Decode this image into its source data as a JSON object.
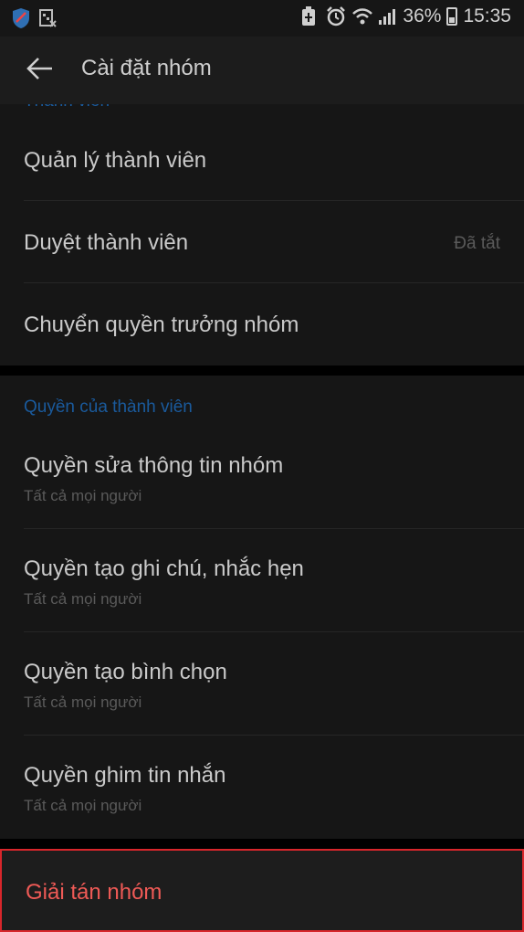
{
  "status_bar": {
    "battery_percent": "36%",
    "time": "15:35",
    "left_icons": [
      "shield-app-icon",
      "tablet-app-icon"
    ],
    "right_icons": [
      "battery-saver-icon",
      "alarm-icon",
      "wifi-icon",
      "signal-icon",
      "battery-icon"
    ]
  },
  "app_bar": {
    "title": "Cài đặt nhóm",
    "back_icon": "arrow-left-icon"
  },
  "section_members": {
    "header": "Thành viên",
    "items": [
      {
        "title": "Quản lý thành viên"
      },
      {
        "title": "Duyệt thành viên",
        "value": "Đã tắt"
      },
      {
        "title": "Chuyển quyền trưởng nhóm"
      }
    ]
  },
  "section_permissions": {
    "header": "Quyền của thành viên",
    "items": [
      {
        "title": "Quyền sửa thông tin nhóm",
        "subtitle": "Tất cả mọi người"
      },
      {
        "title": "Quyền tạo ghi chú, nhắc hẹn",
        "subtitle": "Tất cả mọi người"
      },
      {
        "title": "Quyền tạo bình chọn",
        "subtitle": "Tất cả mọi người"
      },
      {
        "title": "Quyền ghim tin nhắn",
        "subtitle": "Tất cả mọi người"
      }
    ]
  },
  "danger": {
    "label": "Giải tán nhóm"
  },
  "colors": {
    "header_blue": "#1a5a9c",
    "danger_red": "#ef5a56",
    "highlight_border": "#d8262b"
  }
}
